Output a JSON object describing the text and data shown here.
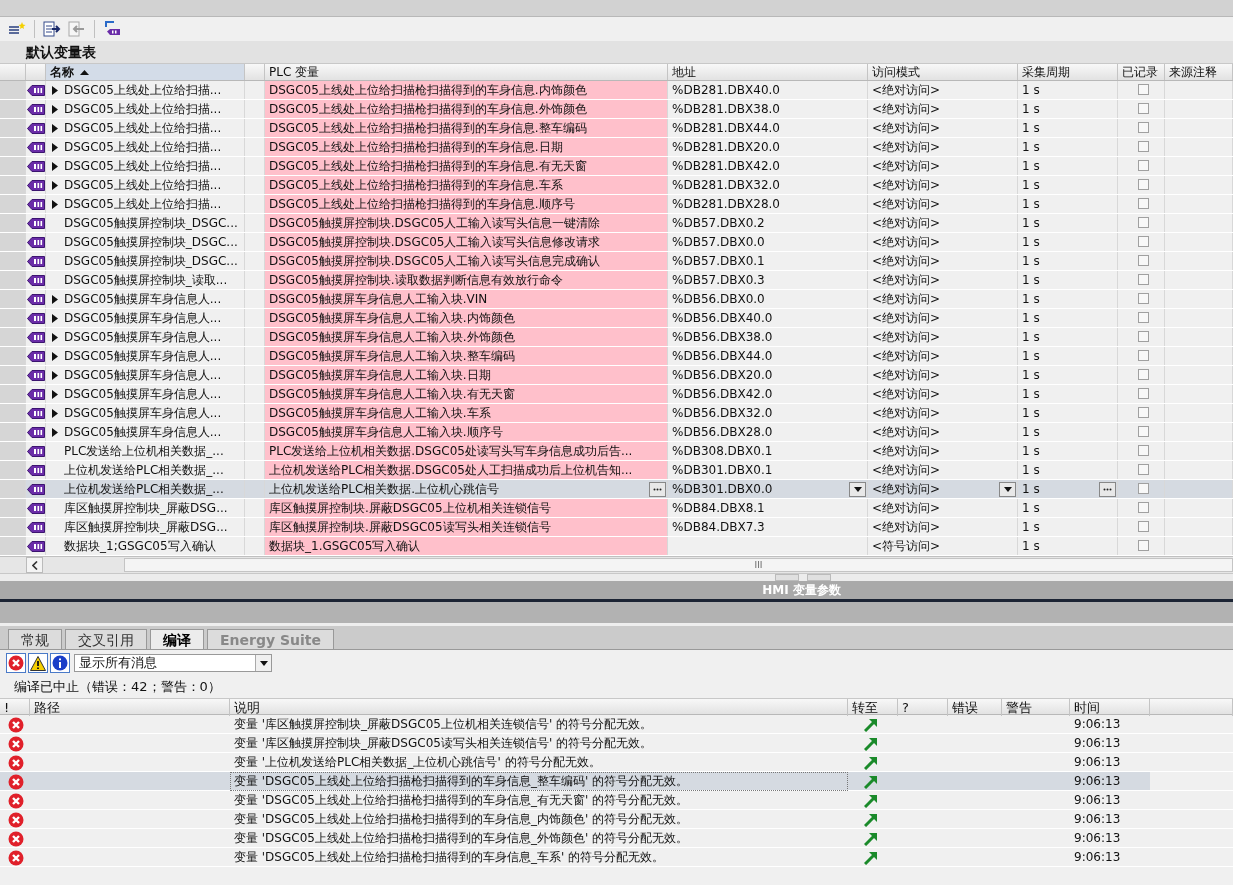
{
  "toolbar": {
    "buttons": [
      {
        "kind": "add",
        "disabled": false
      },
      {
        "kind": "export",
        "disabled": false
      },
      {
        "kind": "import",
        "disabled": true
      },
      {
        "kind": "link",
        "disabled": false
      }
    ]
  },
  "table_title": "默认变量表",
  "columns": [
    {
      "label": "名称",
      "sorted": true
    },
    {
      "label": "PLC 变量",
      "sorted": false
    },
    {
      "label": "地址",
      "sorted": false
    },
    {
      "label": "访问模式",
      "sorted": false
    },
    {
      "label": "采集周期",
      "sorted": false
    },
    {
      "label": "已记录",
      "sorted": false
    },
    {
      "label": "来源注释",
      "sorted": false
    }
  ],
  "rows": [
    {
      "name": "DSGC05上线处上位给扫描...",
      "expandable": true,
      "plc_variable": "DSGC05上线处上位给扫描枪扫描得到的车身信息.内饰颜色",
      "error": true,
      "address": "%DB281.DBX40.0",
      "access": "<绝对访问>",
      "cycle": "1 s",
      "recorded": false,
      "selected": false
    },
    {
      "name": "DSGC05上线处上位给扫描...",
      "expandable": true,
      "plc_variable": "DSGC05上线处上位给扫描枪扫描得到的车身信息.外饰颜色",
      "error": true,
      "address": "%DB281.DBX38.0",
      "access": "<绝对访问>",
      "cycle": "1 s",
      "recorded": false,
      "selected": false
    },
    {
      "name": "DSGC05上线处上位给扫描...",
      "expandable": true,
      "plc_variable": "DSGC05上线处上位给扫描枪扫描得到的车身信息.整车编码",
      "error": true,
      "address": "%DB281.DBX44.0",
      "access": "<绝对访问>",
      "cycle": "1 s",
      "recorded": false,
      "selected": false
    },
    {
      "name": "DSGC05上线处上位给扫描...",
      "expandable": true,
      "plc_variable": "DSGC05上线处上位给扫描枪扫描得到的车身信息.日期",
      "error": true,
      "address": "%DB281.DBX20.0",
      "access": "<绝对访问>",
      "cycle": "1 s",
      "recorded": false,
      "selected": false
    },
    {
      "name": "DSGC05上线处上位给扫描...",
      "expandable": true,
      "plc_variable": "DSGC05上线处上位给扫描枪扫描得到的车身信息.有无天窗",
      "error": true,
      "address": "%DB281.DBX42.0",
      "access": "<绝对访问>",
      "cycle": "1 s",
      "recorded": false,
      "selected": false
    },
    {
      "name": "DSGC05上线处上位给扫描...",
      "expandable": true,
      "plc_variable": "DSGC05上线处上位给扫描枪扫描得到的车身信息.车系",
      "error": true,
      "address": "%DB281.DBX32.0",
      "access": "<绝对访问>",
      "cycle": "1 s",
      "recorded": false,
      "selected": false
    },
    {
      "name": "DSGC05上线处上位给扫描...",
      "expandable": true,
      "plc_variable": "DSGC05上线处上位给扫描枪扫描得到的车身信息.顺序号",
      "error": true,
      "address": "%DB281.DBX28.0",
      "access": "<绝对访问>",
      "cycle": "1 s",
      "recorded": false,
      "selected": false
    },
    {
      "name": "DSGC05触摸屏控制块_DSGC...",
      "expandable": false,
      "plc_variable": "DSGC05触摸屏控制块.DSGC05人工输入读写头信息一键清除",
      "error": true,
      "address": "%DB57.DBX0.2",
      "access": "<绝对访问>",
      "cycle": "1 s",
      "recorded": false,
      "selected": false
    },
    {
      "name": "DSGC05触摸屏控制块_DSGC...",
      "expandable": false,
      "plc_variable": "DSGC05触摸屏控制块.DSGC05人工输入读写头信息修改请求",
      "error": true,
      "address": "%DB57.DBX0.0",
      "access": "<绝对访问>",
      "cycle": "1 s",
      "recorded": false,
      "selected": false
    },
    {
      "name": "DSGC05触摸屏控制块_DSGC...",
      "expandable": false,
      "plc_variable": "DSGC05触摸屏控制块.DSGC05人工输入读写头信息完成确认",
      "error": true,
      "address": "%DB57.DBX0.1",
      "access": "<绝对访问>",
      "cycle": "1 s",
      "recorded": false,
      "selected": false
    },
    {
      "name": "DSGC05触摸屏控制块_读取...",
      "expandable": false,
      "plc_variable": "DSGC05触摸屏控制块.读取数据判断信息有效放行命令",
      "error": true,
      "address": "%DB57.DBX0.3",
      "access": "<绝对访问>",
      "cycle": "1 s",
      "recorded": false,
      "selected": false
    },
    {
      "name": "DSGC05触摸屏车身信息人...",
      "expandable": true,
      "plc_variable": "DSGC05触摸屏车身信息人工输入块.VIN",
      "error": true,
      "address": "%DB56.DBX0.0",
      "access": "<绝对访问>",
      "cycle": "1 s",
      "recorded": false,
      "selected": false
    },
    {
      "name": "DSGC05触摸屏车身信息人...",
      "expandable": true,
      "plc_variable": "DSGC05触摸屏车身信息人工输入块.内饰颜色",
      "error": true,
      "address": "%DB56.DBX40.0",
      "access": "<绝对访问>",
      "cycle": "1 s",
      "recorded": false,
      "selected": false
    },
    {
      "name": "DSGC05触摸屏车身信息人...",
      "expandable": true,
      "plc_variable": "DSGC05触摸屏车身信息人工输入块.外饰颜色",
      "error": true,
      "address": "%DB56.DBX38.0",
      "access": "<绝对访问>",
      "cycle": "1 s",
      "recorded": false,
      "selected": false
    },
    {
      "name": "DSGC05触摸屏车身信息人...",
      "expandable": true,
      "plc_variable": "DSGC05触摸屏车身信息人工输入块.整车编码",
      "error": true,
      "address": "%DB56.DBX44.0",
      "access": "<绝对访问>",
      "cycle": "1 s",
      "recorded": false,
      "selected": false
    },
    {
      "name": "DSGC05触摸屏车身信息人...",
      "expandable": true,
      "plc_variable": "DSGC05触摸屏车身信息人工输入块.日期",
      "error": true,
      "address": "%DB56.DBX20.0",
      "access": "<绝对访问>",
      "cycle": "1 s",
      "recorded": false,
      "selected": false
    },
    {
      "name": "DSGC05触摸屏车身信息人...",
      "expandable": true,
      "plc_variable": "DSGC05触摸屏车身信息人工输入块.有无天窗",
      "error": true,
      "address": "%DB56.DBX42.0",
      "access": "<绝对访问>",
      "cycle": "1 s",
      "recorded": false,
      "selected": false
    },
    {
      "name": "DSGC05触摸屏车身信息人...",
      "expandable": true,
      "plc_variable": "DSGC05触摸屏车身信息人工输入块.车系",
      "error": true,
      "address": "%DB56.DBX32.0",
      "access": "<绝对访问>",
      "cycle": "1 s",
      "recorded": false,
      "selected": false
    },
    {
      "name": "DSGC05触摸屏车身信息人...",
      "expandable": true,
      "plc_variable": "DSGC05触摸屏车身信息人工输入块.顺序号",
      "error": true,
      "address": "%DB56.DBX28.0",
      "access": "<绝对访问>",
      "cycle": "1 s",
      "recorded": false,
      "selected": false
    },
    {
      "name": "PLC发送给上位机相关数据_...",
      "expandable": false,
      "plc_variable": "PLC发送给上位机相关数据.DSGC05处读写头写车身信息成功后告...",
      "error": true,
      "address": "%DB308.DBX0.1",
      "access": "<绝对访问>",
      "cycle": "1 s",
      "recorded": false,
      "selected": false
    },
    {
      "name": "上位机发送给PLC相关数据_...",
      "expandable": false,
      "plc_variable": "上位机发送给PLC相关数据.DSGC05处人工扫描成功后上位机告知...",
      "error": true,
      "address": "%DB301.DBX0.1",
      "access": "<绝对访问>",
      "cycle": "1 s",
      "recorded": false,
      "selected": false
    },
    {
      "name": "上位机发送给PLC相关数据_...",
      "expandable": false,
      "plc_variable": "上位机发送给PLC相关数据.上位机心跳信号",
      "error": false,
      "address": "%DB301.DBX0.0",
      "access": "<绝对访问>",
      "cycle": "1 s",
      "recorded": false,
      "selected": true
    },
    {
      "name": "库区触摸屏控制块_屏蔽DSG...",
      "expandable": false,
      "plc_variable": "库区触摸屏控制块.屏蔽DSGC05上位机相关连锁信号",
      "error": true,
      "address": "%DB84.DBX8.1",
      "access": "<绝对访问>",
      "cycle": "1 s",
      "recorded": false,
      "selected": false
    },
    {
      "name": "库区触摸屏控制块_屏蔽DSG...",
      "expandable": false,
      "plc_variable": "库区触摸屏控制块.屏蔽DSGC05读写头相关连锁信号",
      "error": true,
      "address": "%DB84.DBX7.3",
      "access": "<绝对访问>",
      "cycle": "1 s",
      "recorded": false,
      "selected": false
    },
    {
      "name": "数据块_1;GSGC05写入确认",
      "expandable": false,
      "plc_variable": "数据块_1.GSGC05写入确认",
      "error": true,
      "address": "",
      "access": "<符号访问>",
      "cycle": "1 s",
      "recorded": false,
      "selected": false
    }
  ],
  "scrollbar_grip": "III",
  "panel_title": "HMI 变量参数",
  "tabs": [
    {
      "label": "常规",
      "selected": false,
      "disabled": false
    },
    {
      "label": "交叉引用",
      "selected": false,
      "disabled": false
    },
    {
      "label": "编译",
      "selected": true,
      "disabled": false
    },
    {
      "label": "Energy Suite",
      "selected": false,
      "disabled": true
    }
  ],
  "filter": {
    "value": "显示所有消息"
  },
  "status": "编译已中止（错误：42；警告：0）",
  "message_columns": [
    "!",
    "路径",
    "说明",
    "转至",
    "?",
    "错误",
    "警告",
    "时间"
  ],
  "messages": [
    {
      "kind": "error",
      "description": "变量 '库区触摸屏控制块_屏蔽DSGC05上位机相关连锁信号' 的符号分配无效。",
      "time": "9:06:13",
      "selected": false
    },
    {
      "kind": "error",
      "description": "变量 '库区触摸屏控制块_屏蔽DSGC05读写头相关连锁信号' 的符号分配无效。",
      "time": "9:06:13",
      "selected": false
    },
    {
      "kind": "error",
      "description": "变量 '上位机发送给PLC相关数据_上位机心跳信号' 的符号分配无效。",
      "time": "9:06:13",
      "selected": false
    },
    {
      "kind": "error",
      "description": "变量 'DSGC05上线处上位给扫描枪扫描得到的车身信息_整车编码' 的符号分配无效。",
      "time": "9:06:13",
      "selected": true
    },
    {
      "kind": "error",
      "description": "变量 'DSGC05上线处上位给扫描枪扫描得到的车身信息_有无天窗' 的符号分配无效。",
      "time": "9:06:13",
      "selected": false
    },
    {
      "kind": "error",
      "description": "变量 'DSGC05上线处上位给扫描枪扫描得到的车身信息_内饰颜色' 的符号分配无效。",
      "time": "9:06:13",
      "selected": false
    },
    {
      "kind": "error",
      "description": "变量 'DSGC05上线处上位给扫描枪扫描得到的车身信息_外饰颜色' 的符号分配无效。",
      "time": "9:06:13",
      "selected": false
    },
    {
      "kind": "error",
      "description": "变量 'DSGC05上线处上位给扫描枪扫描得到的车身信息_车系' 的符号分配无效。",
      "time": "9:06:13",
      "selected": false
    }
  ]
}
